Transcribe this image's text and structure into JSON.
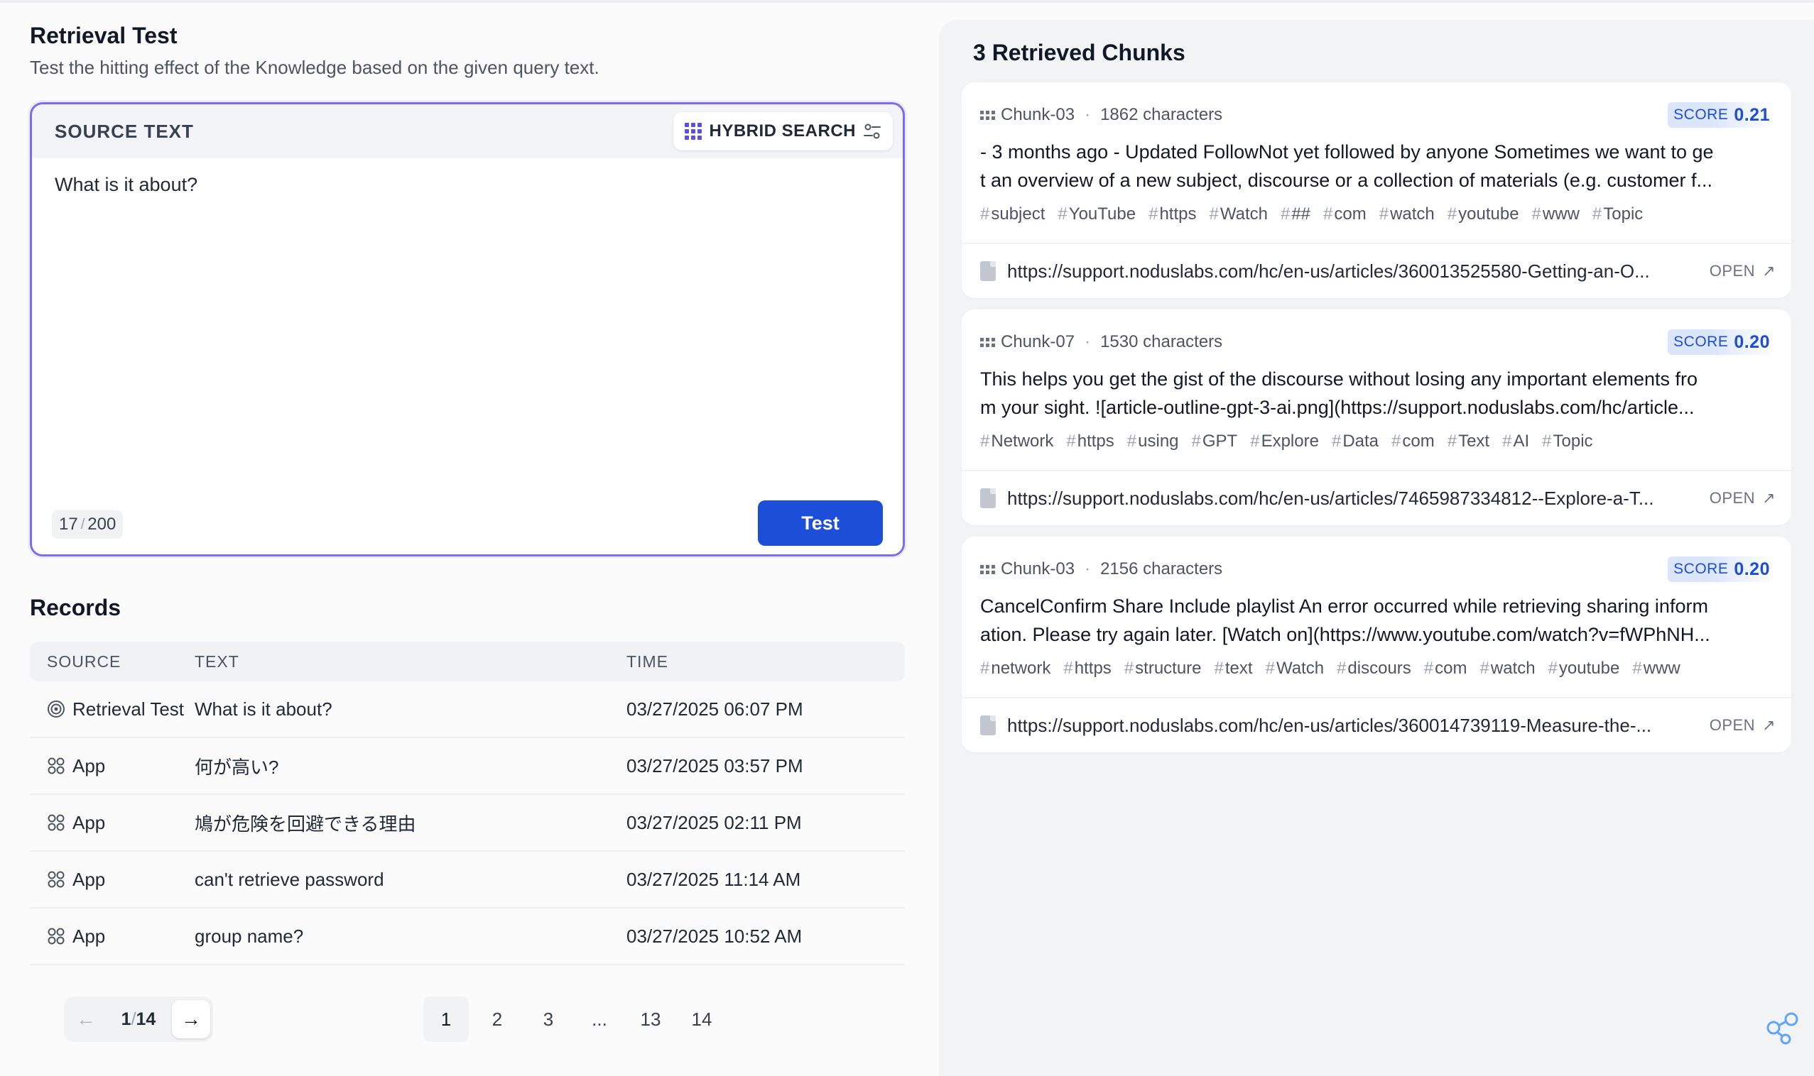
{
  "header": {
    "title": "Retrieval Test",
    "subtitle": "Test the hitting effect of the Knowledge based on the given query text."
  },
  "source": {
    "label": "SOURCE TEXT",
    "mode_label": "HYBRID SEARCH",
    "query": "What is it about?",
    "count_current": "17",
    "count_max": "200",
    "test_label": "Test",
    "accent": "#1d4ed8"
  },
  "records": {
    "title": "Records",
    "columns": [
      "SOURCE",
      "TEXT",
      "TIME"
    ],
    "rows": [
      {
        "source": "Retrieval Test",
        "icon": "target-icon",
        "text": "What is it about?",
        "time": "03/27/2025 06:07 PM"
      },
      {
        "source": "App",
        "icon": "app-icon",
        "text": "何が高い?",
        "time": "03/27/2025 03:57 PM"
      },
      {
        "source": "App",
        "icon": "app-icon",
        "text": "鳩が危険を回避できる理由",
        "time": "03/27/2025 02:11 PM"
      },
      {
        "source": "App",
        "icon": "app-icon",
        "text": "can't retrieve password",
        "time": "03/27/2025 11:14 AM"
      },
      {
        "source": "App",
        "icon": "app-icon",
        "text": "group name?",
        "time": "03/27/2025 10:52 AM"
      }
    ]
  },
  "pagination": {
    "current": "1",
    "total": "14",
    "pages": [
      "1",
      "2",
      "3",
      "...",
      "13",
      "14"
    ]
  },
  "results": {
    "title": "3 Retrieved Chunks",
    "score_label": "SCORE",
    "open_label": "OPEN",
    "chunks": [
      {
        "id": "Chunk-03",
        "chars": "1862 characters",
        "score": "0.21",
        "line1": "- 3 months ago - Updated FollowNot yet followed by anyone Sometimes we want to ge",
        "line2": "t an overview of a new subject, discourse or a collection of materials (e.g. customer f...",
        "tags": [
          "subject",
          "YouTube",
          "https",
          "Watch",
          "##",
          "com",
          "watch",
          "youtube",
          "www",
          "Topic"
        ],
        "url": "https://support.noduslabs.com/hc/en-us/articles/360013525580-Getting-an-O..."
      },
      {
        "id": "Chunk-07",
        "chars": "1530 characters",
        "score": "0.20",
        "line1": "This helps you get the gist of the discourse without losing any important elements fro",
        "line2": "m your sight. ![article-outline-gpt-3-ai.png](https://support.noduslabs.com/hc/article...",
        "tags": [
          "Network",
          "https",
          "using",
          "GPT",
          "Explore",
          "Data",
          "com",
          "Text",
          "AI",
          "Topic"
        ],
        "url": "https://support.noduslabs.com/hc/en-us/articles/7465987334812--Explore-a-T..."
      },
      {
        "id": "Chunk-03",
        "chars": "2156 characters",
        "score": "0.20",
        "line1": "CancelConfirm Share Include playlist An error occurred while retrieving sharing inform",
        "line2": "ation. Please try again later. [Watch on](https://www.youtube.com/watch?v=fWPhNH...",
        "tags": [
          "network",
          "https",
          "structure",
          "text",
          "Watch",
          "discours",
          "com",
          "watch",
          "youtube",
          "www"
        ],
        "url": "https://support.noduslabs.com/hc/en-us/articles/360014739119-Measure-the-..."
      }
    ]
  }
}
